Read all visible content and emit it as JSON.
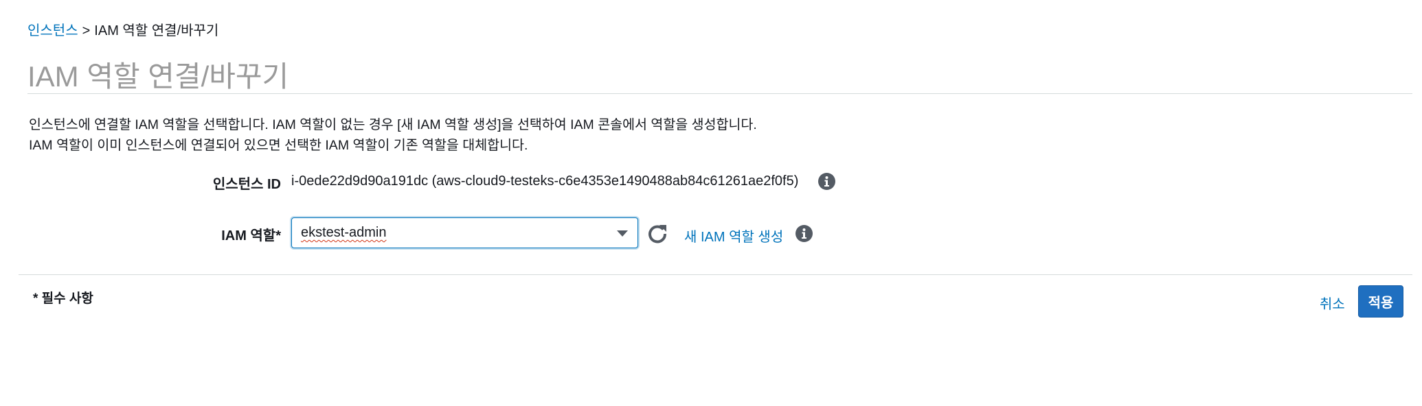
{
  "breadcrumb": {
    "parent": "인스턴스",
    "separator": ">",
    "current": "IAM 역할 연결/바꾸기"
  },
  "page_title": "IAM 역할 연결/바꾸기",
  "description": {
    "line1": "인스턴스에 연결할 IAM 역할을 선택합니다. IAM 역할이 없는 경우 [새 IAM 역할 생성]을 선택하여 IAM 콘솔에서 역할을 생성합니다.",
    "line2": "IAM 역할이 이미 인스턴스에 연결되어 있으면 선택한 IAM 역할이 기존 역할을 대체합니다."
  },
  "form": {
    "instance_id_label": "인스턴스 ID",
    "instance_id_value": "i-0ede22d9d90a191dc (aws-cloud9-testeks-c6e4353e1490488ab84c61261ae2f0f5)",
    "iam_role_label": "IAM 역할*",
    "iam_role_value": "ekstest-admin",
    "create_role_link": "새 IAM 역할 생성"
  },
  "icons": {
    "info": "info-icon",
    "refresh": "refresh-icon",
    "dropdown": "chevron-down-icon"
  },
  "footer": {
    "required_note": "* 필수 사항",
    "cancel_label": "취소",
    "apply_label": "적용"
  },
  "colors": {
    "link": "#0073bb",
    "primary_button": "#1f6fc0",
    "title_gray": "#9a9a9a"
  }
}
